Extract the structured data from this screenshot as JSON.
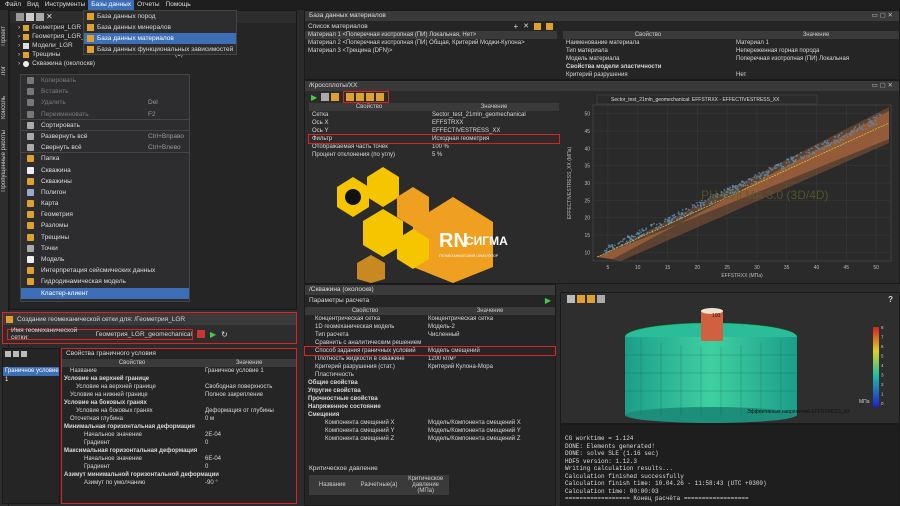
{
  "menubar": [
    "Файл",
    "Вид",
    "Инструменты",
    "Базы данных",
    "Отчеты",
    "Помощь"
  ],
  "db_menu": [
    "База данных пород",
    "База данных минералов",
    "База данных материалов",
    "База данных функциональных зависимостей"
  ],
  "sidebar_tabs": [
    "Проект",
    "Лог",
    "Консоль",
    "Пропущенные работы"
  ],
  "tree": {
    "items": [
      "Геометрия_LGR",
      "Геометрия_LGR_geo",
      "Модели_LGR",
      "Трещины",
      "Скважина (околоскв)"
    ],
    "count": "(1)"
  },
  "context_menu": {
    "items": [
      {
        "label": "Копировать",
        "sc": "",
        "dis": true,
        "color": "#777"
      },
      {
        "label": "Вставить",
        "sc": "",
        "dis": true,
        "color": "#777"
      },
      {
        "label": "Удалить",
        "sc": "Del",
        "dis": true,
        "color": "#777"
      },
      {
        "label": "Переименовать",
        "sc": "F2",
        "dis": true,
        "color": "#777"
      },
      {
        "label": "Сортировать",
        "sc": "",
        "dis": false,
        "color": "#aaa"
      },
      {
        "label": "Развернуть всё",
        "sc": "Ctrl+Вправо",
        "dis": false,
        "color": "#aaa"
      },
      {
        "label": "Свернуть всё",
        "sc": "Ctrl+Влево",
        "dis": false,
        "color": "#aaa"
      },
      {
        "label": "Папка",
        "sc": "",
        "dis": false,
        "color": "#e0a030"
      },
      {
        "label": "Скважина",
        "sc": "",
        "dis": false,
        "color": "#eee"
      },
      {
        "label": "Скважины",
        "sc": "",
        "dis": false,
        "color": "#e0a030"
      },
      {
        "label": "Полигон",
        "sc": "",
        "dis": false,
        "color": "#9ac"
      },
      {
        "label": "Карта",
        "sc": "",
        "dis": false,
        "color": "#e0a030"
      },
      {
        "label": "Геометрия",
        "sc": "",
        "dis": false,
        "color": "#e0a030"
      },
      {
        "label": "Разломы",
        "sc": "",
        "dis": false,
        "color": "#e0a030"
      },
      {
        "label": "Трещины",
        "sc": "",
        "dis": false,
        "color": "#e0a030"
      },
      {
        "label": "Точки",
        "sc": "",
        "dis": false,
        "color": "#aaa"
      },
      {
        "label": "Модель",
        "sc": "",
        "dis": false,
        "color": "#eee"
      },
      {
        "label": "Интерпретация сейсмических данных",
        "sc": "",
        "dis": false,
        "color": "#e0a030"
      },
      {
        "label": "Гидродинамическая модель",
        "sc": "",
        "dis": false,
        "color": "#e0a030"
      },
      {
        "label": "Кластер-клиент",
        "sc": "",
        "dis": false,
        "color": "#3d6fb6"
      }
    ]
  },
  "grid_dialog": {
    "title": "Создание геомеханической сетки для: /Геометрия_LGR",
    "label": "Имя геомеханической сетки:",
    "value": "Геометрия_LGR_geomechanical"
  },
  "boundary": {
    "title": "Свойства граничного условия",
    "list_item": "Граничное условие 1",
    "cols": [
      "Свойство",
      "Значение"
    ],
    "rows": [
      [
        "Название",
        "Граничное условие 1",
        "0"
      ],
      [
        "Условие на верхней границе",
        "",
        "1"
      ],
      [
        "Условие на верхней границе",
        "Свободная поверхность",
        "2"
      ],
      [
        "Условие на нижней границе",
        "Полное закрепление",
        "0"
      ],
      [
        "Условие на боковых гранях",
        "",
        "1"
      ],
      [
        "Условие на боковых гранях",
        "Деформация от глубины",
        "2"
      ],
      [
        "Отсчетная глубина",
        "0 м",
        "0"
      ],
      [
        "Минимальная горизонтальная деформация",
        "",
        "1"
      ],
      [
        "Начальное значение",
        "2E-04",
        "3"
      ],
      [
        "Градиент",
        "0",
        "3"
      ],
      [
        "Максимальная горизонтальная деформация",
        "",
        "1"
      ],
      [
        "Начальное значение",
        "6E-04",
        "3"
      ],
      [
        "Градиент",
        "0",
        "3"
      ],
      [
        "Азимут минимальной горизонтальной деформации",
        "",
        "1"
      ],
      [
        "Азимут по умолчанию",
        "-90 °",
        "3"
      ]
    ]
  },
  "materials": {
    "title": "База данных материалов",
    "list_title": "Список материалов",
    "items": [
      "Материал 1 <Поперечная изотропная (ПИ) Локальная, Нет>",
      "Материал 2 <Поперечная изотропная (ПИ) Общая, Критерий Моджи-Кулона>",
      "Материал 3 <Трещина (DFN)>"
    ],
    "cols": [
      "Свойство",
      "Значение"
    ],
    "props": [
      [
        "Наименование материала",
        "Материал 1",
        ""
      ],
      [
        "Тип материала",
        "Непереженная горная порода",
        ""
      ],
      [
        "Модель материала",
        "Поперечная изотропная (ПИ) Локальная",
        ""
      ],
      [
        "Свойства модели эластичности",
        "",
        "b"
      ],
      [
        "Критерий разрушения",
        "Нет",
        ""
      ]
    ]
  },
  "crossplot": {
    "title": "/Кроссплоты/XX",
    "cols": [
      "Свойство",
      "Значение"
    ],
    "rows": [
      [
        "Сетка",
        "Sector_test_21mln_geomechanical"
      ],
      [
        "Ось X",
        "EFFSTRXX"
      ],
      [
        "Ось Y",
        "EFFECTIVESTRESS_XX"
      ],
      [
        "Фильтр",
        "Исходная геометрия"
      ],
      [
        "Отображаемая часть точек",
        "100 %"
      ],
      [
        "Процент отклонения (по углу)",
        "5 %"
      ]
    ],
    "legend": "Sector_test_21mln_geomechanical: EFFSTRXX - EFFECTIVESTRESS_XX",
    "xlabel": "EFFSTRXX (МПа)",
    "ylabel": "EFFECTIVESTRESS_XX (МПа)",
    "xticks": [
      "5",
      "10",
      "15",
      "20",
      "25",
      "30",
      "35",
      "40",
      "45",
      "50"
    ],
    "yticks": [
      "10",
      "15",
      "20",
      "25",
      "30",
      "35",
      "40",
      "45",
      "50"
    ]
  },
  "watermark": "РН-СИГМА 3.0 (3D/4D)",
  "logo": {
    "rn": "RN",
    "name": "СИГМА",
    "sub": "ГЕОМЕХАНИЧЕСКИЙ СИМУЛЯТОР"
  },
  "well": {
    "title": "/Скважина (околоскв)",
    "params_title": "Параметры расчета",
    "cols": [
      "Свойство",
      "Значение"
    ],
    "rows": [
      [
        "Концентрическая сетка",
        "Концентрическая сетка",
        ""
      ],
      [
        "1D геомеханическая модель",
        "Модель-2",
        ""
      ],
      [
        "Тип расчета",
        "Численный",
        ""
      ],
      [
        "Сравнить с аналитическим решением",
        "",
        ""
      ],
      [
        "Способ задания граничных условий",
        "Модель смещений",
        "r"
      ],
      [
        "Плотность жидкости в скважине",
        "1200 кг/м³",
        ""
      ],
      [
        "Критерий разрушения (стат.)",
        "Критерий Кулона-Мора",
        ""
      ],
      [
        "Пластичность",
        "",
        ""
      ],
      [
        "Общие свойства",
        "",
        "b"
      ],
      [
        "Упругие свойства",
        "",
        "b"
      ],
      [
        "Прочностные свойства",
        "",
        "b"
      ],
      [
        "Напряженное состояние",
        "",
        "b"
      ],
      [
        "Смещения",
        "",
        "b"
      ],
      [
        "Компонента смещений X",
        "Модель/Компонента смещений X",
        ""
      ],
      [
        "Компонента смещений Y",
        "Модель/Компонента смещений Y",
        ""
      ],
      [
        "Компонента смещений Z",
        "Модель/Компонента смещений Z",
        ""
      ]
    ],
    "crit_title": "Критическое давление",
    "crit_cols": [
      "Название",
      "Разчетные(а)",
      "Критическое давление (МПа)"
    ]
  },
  "view3d": {
    "label": "Эффективных напряжений EFFSTRESS_XX",
    "scale": [
      "8",
      "7",
      "6",
      "5",
      "4",
      "3",
      "2",
      "1",
      "0"
    ],
    "top_value": "100",
    "unit": "МПа"
  },
  "console": [
    "CG worktime = 1.124",
    "DONE: Elements generated!",
    "DONE: solve SLE (1.16 sec)",
    "HDF5 version: 1.12.3",
    "Writing calculation results...",
    "Calculation finished successfully",
    "",
    "Calculation finish time: 10.04.26 - 11:58:43 (UTC +0300)",
    "Calculation time: 00:00:03",
    "================== Конец расчёта =================="
  ],
  "colors": {
    "accent": "#3d6fb6",
    "red": "#d22222",
    "orange": "#f0a020"
  }
}
